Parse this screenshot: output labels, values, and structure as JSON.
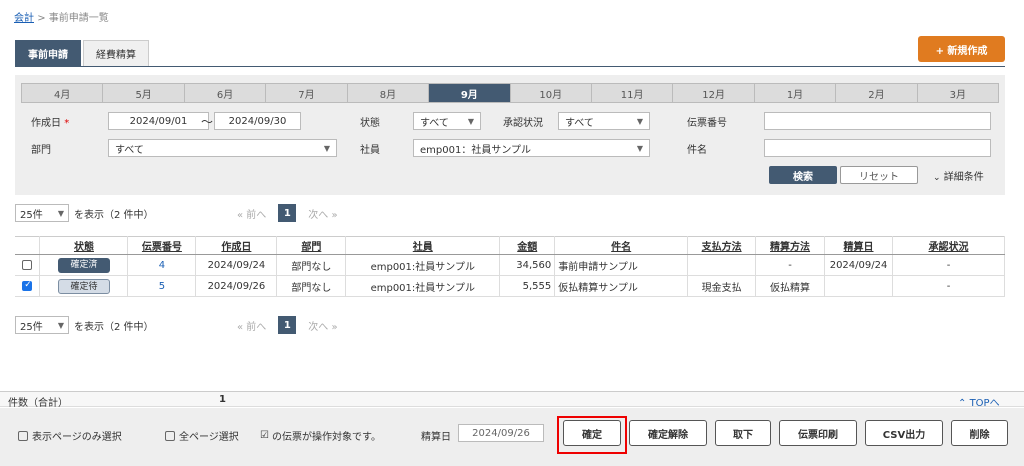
{
  "breadcrumb": {
    "root": "会計",
    "sep": ">",
    "current": "事前申請一覧"
  },
  "tabs": [
    "事前申請",
    "経費精算"
  ],
  "new_button": "+ 新規作成",
  "months": [
    "4月",
    "5月",
    "6月",
    "7月",
    "8月",
    "9月",
    "10月",
    "11月",
    "12月",
    "1月",
    "2月",
    "3月"
  ],
  "active_month": "9月",
  "search": {
    "created_label": "作成日",
    "required_mark": "*",
    "date_from": "2024/09/01",
    "tilde": "〜",
    "date_to": "2024/09/30",
    "state_label": "状態",
    "state_value": "すべて",
    "approval_label": "承認状況",
    "approval_value": "すべて",
    "voucher_label": "伝票番号",
    "voucher_value": "",
    "dept_label": "部門",
    "dept_value": "すべて",
    "employee_label": "社員",
    "employee_value": "emp001：社員サンプル",
    "subject_label": "件名",
    "subject_value": "",
    "search_button": "検索",
    "reset_button": "リセット",
    "advanced_toggle": "詳細条件"
  },
  "pager": {
    "size": "25件",
    "display_text": "を表示（2 件中）",
    "prev": "« 前へ",
    "page": "1",
    "next": "次へ »"
  },
  "table": {
    "headers": [
      "状態",
      "伝票番号",
      "作成日",
      "部門",
      "社員",
      "金額",
      "件名",
      "支払方法",
      "精算方法",
      "精算日",
      "承認状況"
    ],
    "rows": [
      {
        "checked": false,
        "status": "確定済",
        "number": "4",
        "date": "2024/09/24",
        "dept": "部門なし",
        "employee": "emp001:社員サンプル",
        "amount": "34,560",
        "subject": "事前申請サンプル",
        "payment": "",
        "settle_method": "-",
        "settle_date": "2024/09/24",
        "approval": "-"
      },
      {
        "checked": true,
        "status": "確定待",
        "number": "5",
        "date": "2024/09/26",
        "dept": "部門なし",
        "employee": "emp001:社員サンプル",
        "amount": "5,555",
        "subject": "仮払精算サンプル",
        "payment": "現金支払",
        "settle_method": "仮払精算",
        "settle_date": "",
        "approval": "-"
      }
    ]
  },
  "summary": {
    "label": "件数（合計）",
    "count": "1",
    "top_link": "TOPへ"
  },
  "footer": {
    "select_page": "表示ページのみ選択",
    "select_all": "全ページ選択",
    "note": "の伝票が操作対象です。",
    "settle_label": "精算日",
    "settle_date": "2024/09/26",
    "buttons": [
      "確定",
      "確定解除",
      "取下",
      "伝票印刷",
      "CSV出力",
      "削除"
    ]
  },
  "colors": {
    "accent": "#435a72",
    "new_button": "#e07b20",
    "highlight": "#e00000"
  }
}
